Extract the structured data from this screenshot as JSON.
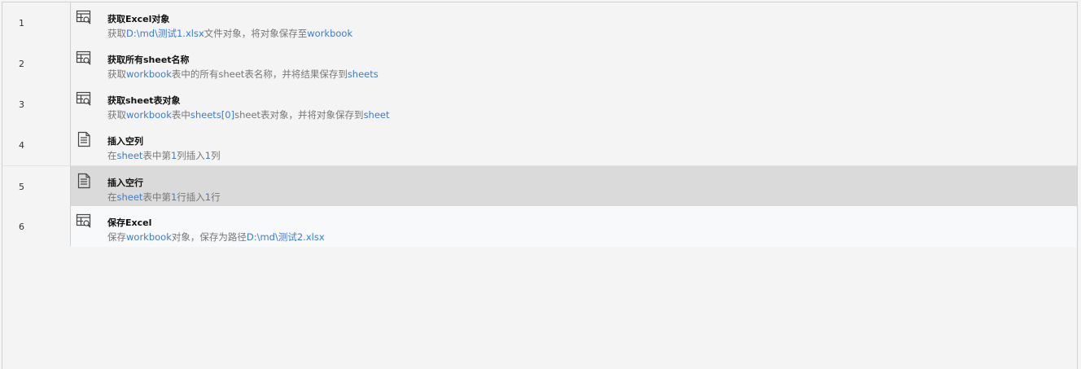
{
  "colors": {
    "highlight": "#3a7dd4",
    "selected_row": "#dadada",
    "muted_text": "#777777"
  },
  "rows": [
    {
      "num": "1",
      "icon": "table-search-icon",
      "title": "获取Excel对象",
      "desc": [
        {
          "t": "获取"
        },
        {
          "t": "D:\\md\\测试1.xlsx",
          "h": true
        },
        {
          "t": "文件对象，将对象保存至"
        },
        {
          "t": "workbook",
          "h": true
        }
      ]
    },
    {
      "num": "2",
      "icon": "table-search-icon",
      "title": "获取所有sheet名称",
      "desc": [
        {
          "t": "获取"
        },
        {
          "t": "workbook",
          "h": true
        },
        {
          "t": "表中的所有sheet表名称，并将结果保存到"
        },
        {
          "t": "sheets",
          "h": true
        }
      ]
    },
    {
      "num": "3",
      "icon": "table-search-icon",
      "title": "获取sheet表对象",
      "desc": [
        {
          "t": "获取"
        },
        {
          "t": "workbook",
          "h": true
        },
        {
          "t": "表中"
        },
        {
          "t": "sheets[0]",
          "h": true
        },
        {
          "t": "sheet表对象，并将对象保存到"
        },
        {
          "t": "sheet",
          "h": true
        }
      ]
    },
    {
      "num": "4",
      "icon": "document-icon",
      "title": "插入空列",
      "desc": [
        {
          "t": "在"
        },
        {
          "t": "sheet",
          "h": true
        },
        {
          "t": "表中第"
        },
        {
          "t": "1",
          "h": true
        },
        {
          "t": "列插入"
        },
        {
          "t": "1",
          "h": true
        },
        {
          "t": "列"
        }
      ]
    },
    {
      "num": "5",
      "icon": "document-icon",
      "title": "插入空行",
      "selected": true,
      "desc": [
        {
          "t": "在"
        },
        {
          "t": "sheet",
          "h": true
        },
        {
          "t": "表中第"
        },
        {
          "t": "1",
          "h": true
        },
        {
          "t": "行插入"
        },
        {
          "t": "1",
          "h": true
        },
        {
          "t": "行"
        }
      ]
    },
    {
      "num": "6",
      "icon": "table-search-icon",
      "title": "保存Excel",
      "desc": [
        {
          "t": "保存"
        },
        {
          "t": "workbook",
          "h": true
        },
        {
          "t": "对象，保存为路径"
        },
        {
          "t": "D:\\md\\测试2.xlsx",
          "h": true
        }
      ]
    }
  ]
}
